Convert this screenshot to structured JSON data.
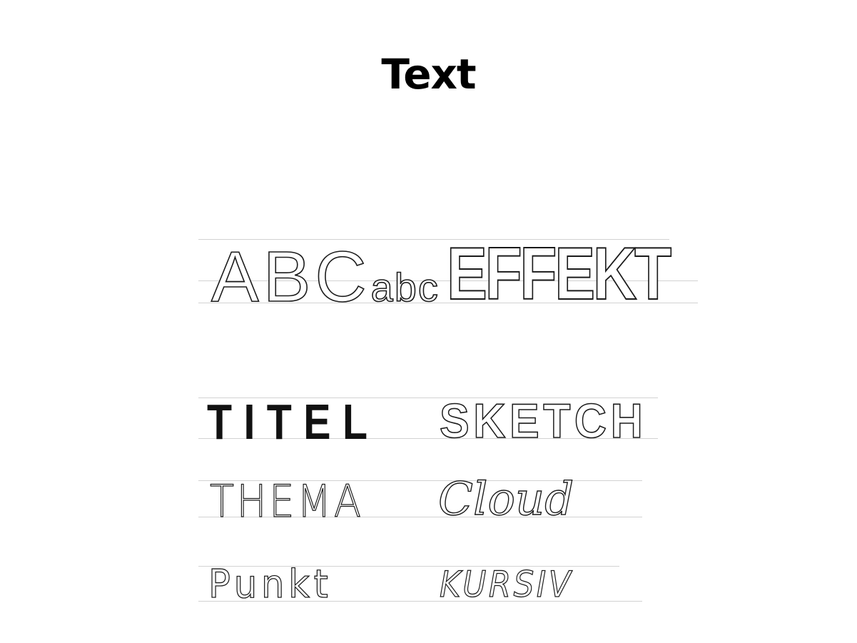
{
  "title": "Text",
  "samples": {
    "abc_upper": "ABC",
    "abc_lower": "abc",
    "effekt": "EFFEKT",
    "titel": "TITEL",
    "sketch": "SKETCH",
    "thema": "THEMA",
    "cloud": "Cloud",
    "punkt": "Punkt",
    "kursiv": "KURSIV"
  },
  "colors": {
    "ink": "#1a1a1a",
    "guide_line": "#d2d2d2",
    "background": "#ffffff"
  }
}
